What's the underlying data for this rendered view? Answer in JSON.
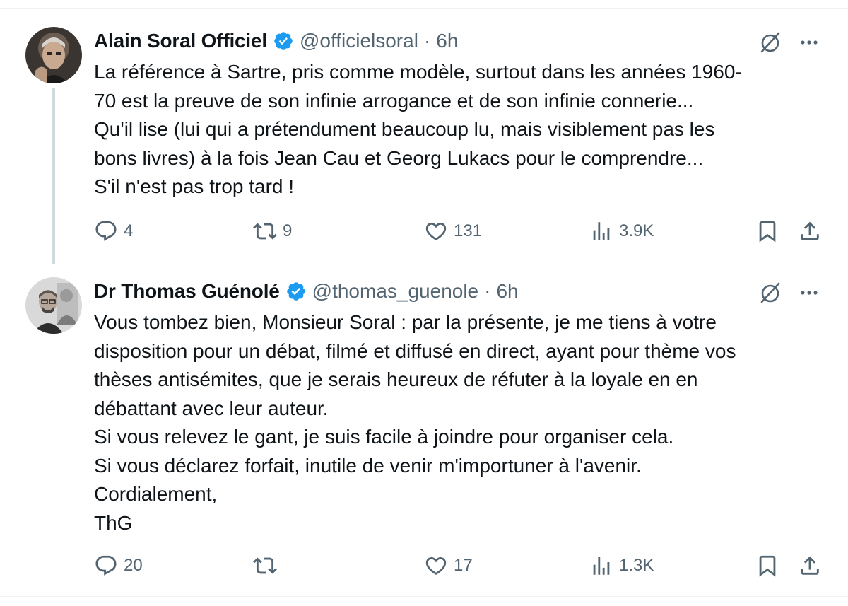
{
  "colors": {
    "text": "#0f1419",
    "muted": "#536471",
    "verified": "#1d9bf0",
    "divider": "#eff3f4",
    "thread_line": "#cfd9de"
  },
  "tweets": [
    {
      "author_name": "Alain Soral Officiel",
      "handle": "@officielsoral",
      "separator": "·",
      "time": "6h",
      "verified": true,
      "text_lines": [
        "La référence à Sartre, pris comme modèle, surtout dans les années 1960-",
        "70 est la preuve de son infinie arrogance et de son infinie connerie...",
        "Qu'il lise (lui qui a prétendument beaucoup lu, mais visiblement pas les",
        "bons livres) à la fois Jean Cau et Georg Lukacs pour le comprendre...",
        "S'il n'est pas trop tard !"
      ],
      "replies": "4",
      "reposts": "9",
      "likes": "131",
      "views": "3.9K",
      "icons": [
        "grok-icon",
        "more-icon",
        "reply-icon",
        "repost-icon",
        "like-icon",
        "views-icon",
        "bookmark-icon",
        "share-icon"
      ]
    },
    {
      "author_name": "Dr Thomas Guénolé",
      "handle": "@thomas_guenole",
      "separator": "·",
      "time": "6h",
      "verified": true,
      "text_lines": [
        "Vous tombez bien, Monsieur Soral : par la présente, je me tiens à votre",
        "disposition pour un débat, filmé et diffusé en direct, ayant pour thème vos",
        "thèses antisémites, que je serais heureux de réfuter à la loyale en en",
        "débattant avec leur auteur.",
        "Si vous relevez le gant, je suis facile à joindre pour organiser cela.",
        "Si vous déclarez forfait, inutile de venir m'importuner à l'avenir.",
        "Cordialement,",
        "ThG"
      ],
      "replies": "20",
      "reposts": "",
      "likes": "17",
      "views": "1.3K",
      "icons": [
        "grok-icon",
        "more-icon",
        "reply-icon",
        "repost-icon",
        "like-icon",
        "views-icon",
        "bookmark-icon",
        "share-icon"
      ]
    }
  ]
}
